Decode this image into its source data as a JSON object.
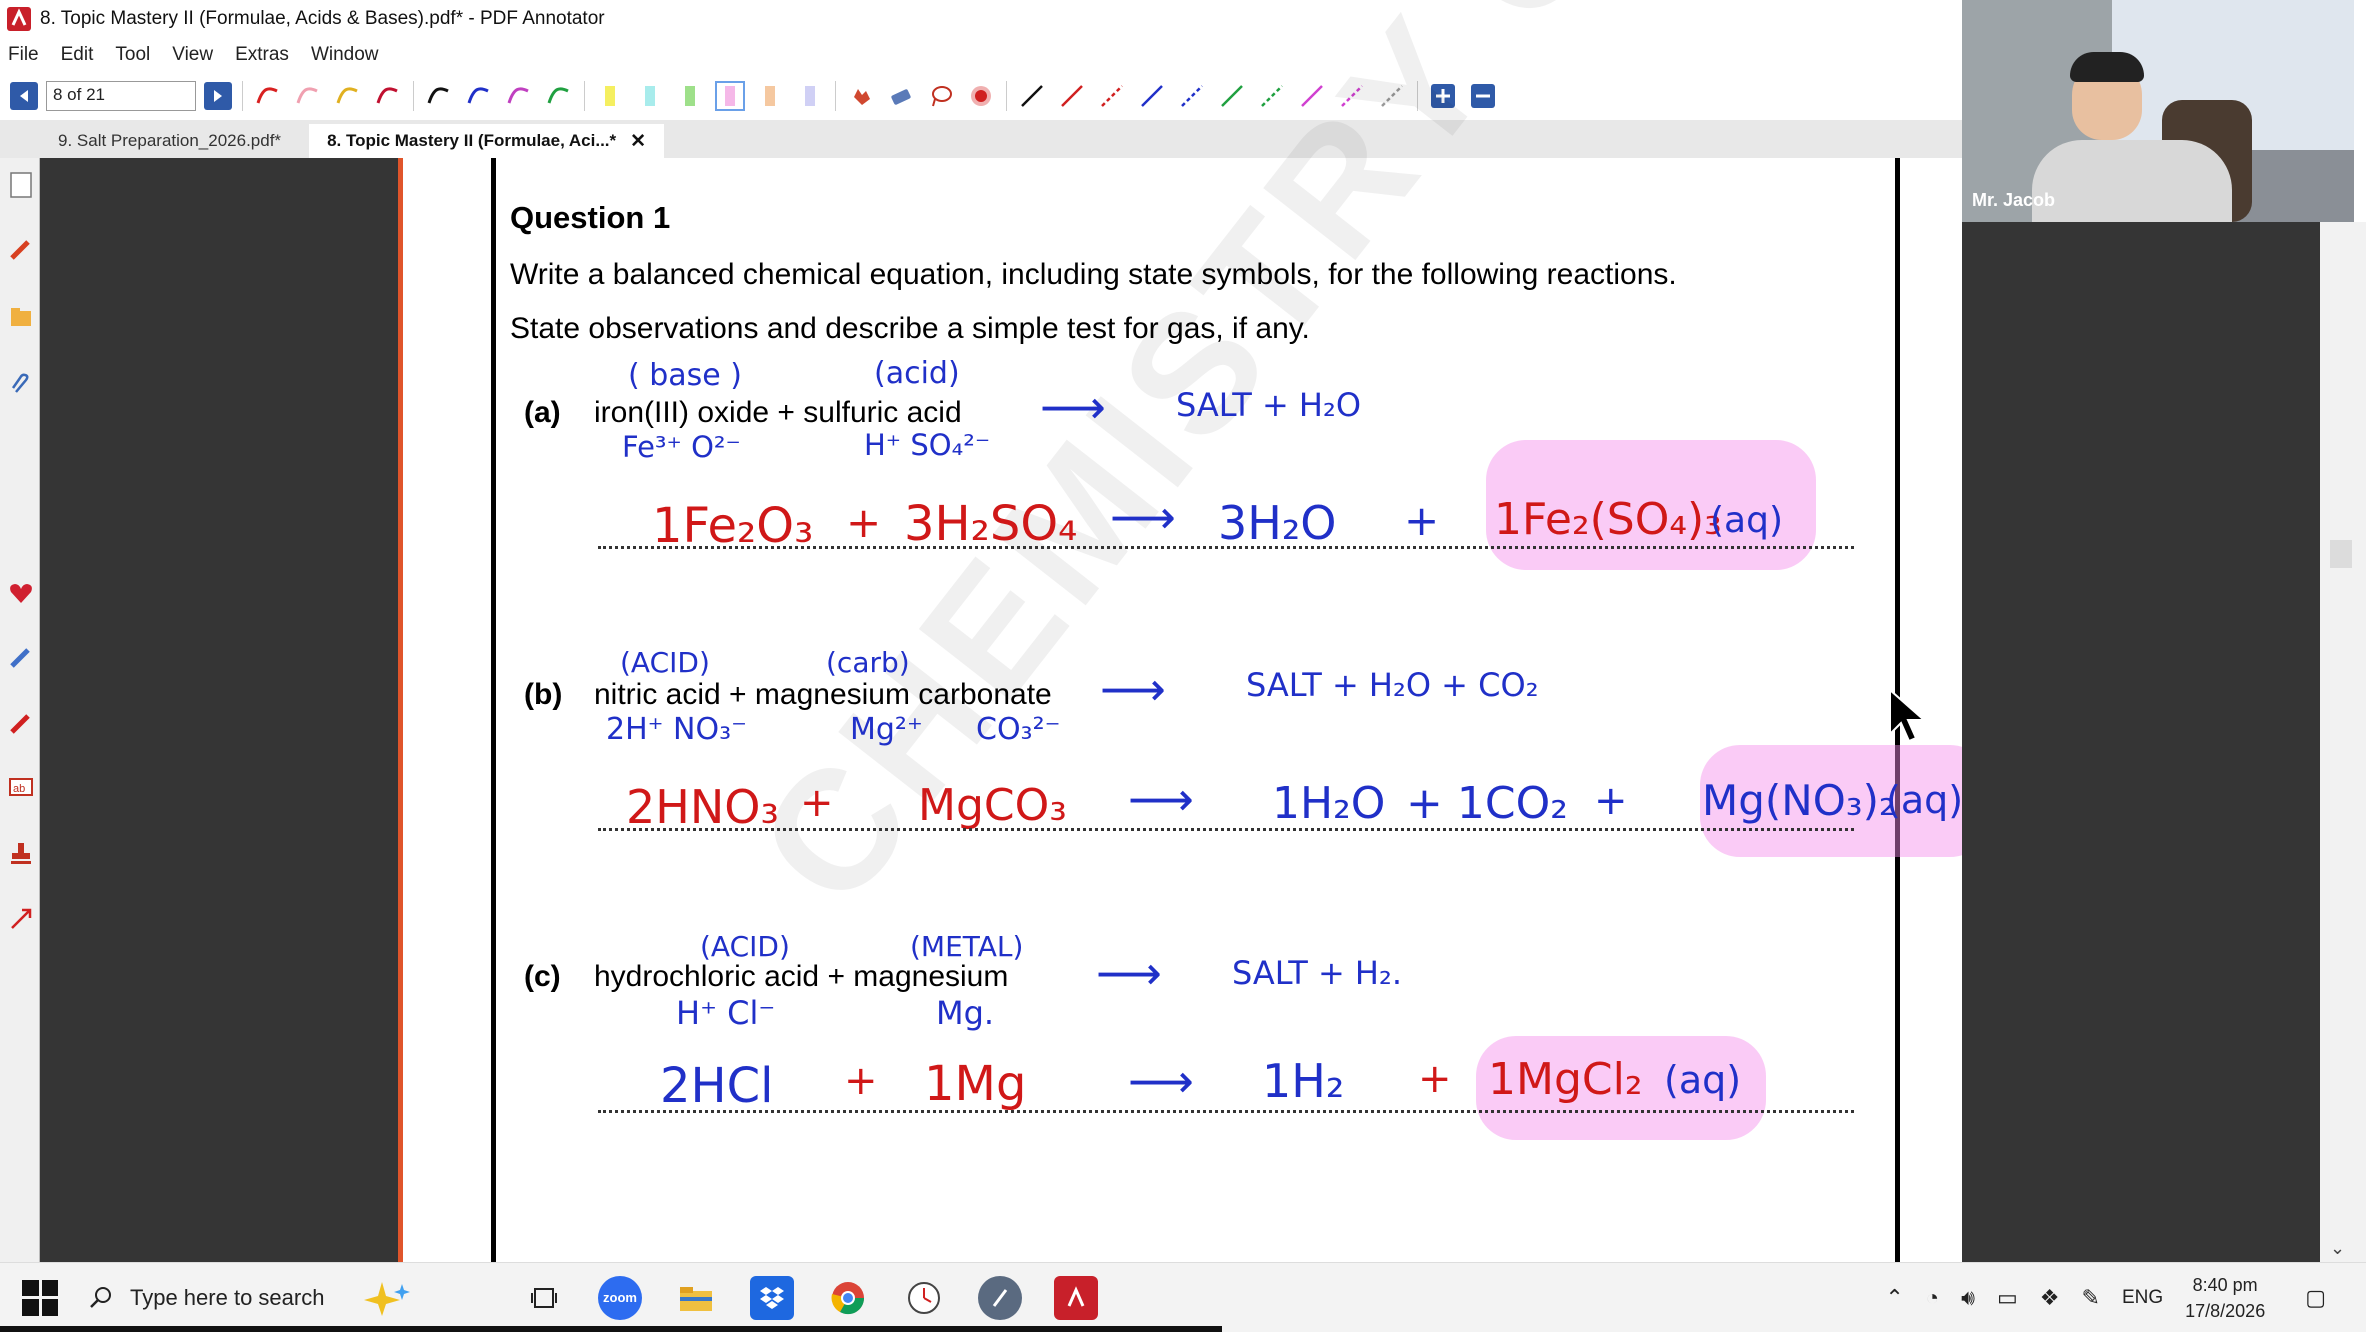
{
  "window": {
    "title": "8. Topic Mastery II (Formulae, Acids & Bases).pdf* - PDF Annotator"
  },
  "menu": [
    "File",
    "Edit",
    "Tool",
    "View",
    "Extras",
    "Window"
  ],
  "toolbar": {
    "page_indicator": "8 of 21"
  },
  "tabs": [
    {
      "label": "9. Salt Preparation_2026.pdf*",
      "active": false
    },
    {
      "label": "8. Topic Mastery II (Formulae, Aci...*",
      "active": true,
      "close": "✕"
    }
  ],
  "document": {
    "question_title": "Question 1",
    "instruction_1": "Write a balanced chemical equation, including state symbols, for the following reactions.",
    "instruction_2": "State observations and describe a simple test for gas, if any.",
    "parts": [
      {
        "label": "(a)",
        "text": "iron(III) oxide + sulfuric acid"
      },
      {
        "label": "(b)",
        "text": "nitric acid + magnesium carbonate"
      },
      {
        "label": "(c)",
        "text": "hydrochloric acid + magnesium"
      }
    ],
    "handwriting": {
      "a_above_1": "( base )",
      "a_above_2": "(acid)",
      "a_ions_1": "Fe³⁺   O²⁻",
      "a_ions_2": "H⁺  SO₄²⁻",
      "a_arrow": "⟶",
      "a_general": "SALT + H₂O",
      "a_eq_1": "1Fe₂O₃",
      "a_eq_plus1": "+",
      "a_eq_2": "3H₂SO₄",
      "a_eq_arrow": "⟶",
      "a_eq_3": "3H₂O",
      "a_eq_plus2": "+",
      "a_eq_4": "1Fe₂(SO₄)₃",
      "a_eq_state": "(aq)",
      "b_above_1": "(ACID)",
      "b_above_2": "(carb)",
      "b_ions_1": "2H⁺  NO₃⁻",
      "b_ions_2": "Mg²⁺",
      "b_ions_3": "CO₃²⁻",
      "b_arrow": "⟶",
      "b_general": "SALT + H₂O + CO₂",
      "b_eq_1": "2HNO₃",
      "b_eq_plus1": "+",
      "b_eq_2": "MgCO₃",
      "b_eq_arrow": "⟶",
      "b_eq_3": "1H₂O",
      "b_eq_4": "+ 1CO₂",
      "b_eq_plus2": "+",
      "b_eq_5": "Mg(NO₃)₂",
      "b_eq_state": "(aq)",
      "c_above_1": "(ACID)",
      "c_above_2": "(METAL)",
      "c_ions_1": "H⁺  Cl⁻",
      "c_ions_2": "Mg.",
      "c_arrow": "⟶",
      "c_general": "SALT + H₂.",
      "c_eq_1": "2HCl",
      "c_eq_plus1": "+",
      "c_eq_2": "1Mg",
      "c_eq_arrow": "⟶",
      "c_eq_3": "1H₂",
      "c_eq_plus2": "+",
      "c_eq_4": "1MgCl₂",
      "c_eq_state": "(aq)"
    },
    "watermark": "CHEMISTRY CAFE"
  },
  "video": {
    "participant_name": "Mr. Jacob"
  },
  "taskbar": {
    "search_placeholder": "Type here to search",
    "language": "ENG",
    "time": "8:40 pm",
    "date": "17/8/2026"
  },
  "colors": {
    "ink_blue": "#2030c8",
    "ink_red": "#d01818",
    "highlight_pink": "#f58ceb",
    "accent_orange": "#e0552b"
  }
}
